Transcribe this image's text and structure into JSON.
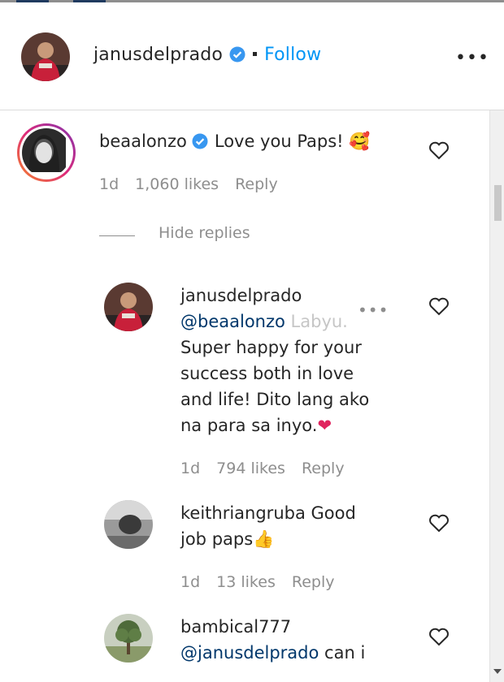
{
  "header": {
    "username": "janusdelprado",
    "follow_label": "Follow",
    "more_label": "•••"
  },
  "comments": [
    {
      "username": "beaalonzo",
      "verified": true,
      "text": "Love you Paps!",
      "emoji": "🥰",
      "time": "1d",
      "likes": "1,060 likes",
      "reply_label": "Reply",
      "hide_replies_label": "Hide replies"
    }
  ],
  "replies": [
    {
      "username": "janusdelprado",
      "mention": "@beaalonzo",
      "text_lines": [
        "Labyu.",
        "Super happy for your",
        "success both in love",
        "and life! Dito lang ako",
        "na para sa inyo."
      ],
      "emoji": "❤",
      "time": "1d",
      "likes": "794 likes",
      "reply_label": "Reply",
      "more_label": "•••"
    },
    {
      "username": "keithriangruba",
      "text_lines": [
        "Good",
        "job paps"
      ],
      "emoji": "👍",
      "time": "1d",
      "likes": "13 likes",
      "reply_label": "Reply"
    },
    {
      "username": "bambical777",
      "mention": "@janusdelprado",
      "text": "can i"
    }
  ],
  "icons": {
    "verified": "verified-badge-icon",
    "heart": "heart-outline-icon",
    "more": "more-options-icon"
  },
  "colors": {
    "link_blue": "#0095f6",
    "mention_blue": "#00376b",
    "muted": "#8e8e8e",
    "verified": "#3897f0"
  }
}
